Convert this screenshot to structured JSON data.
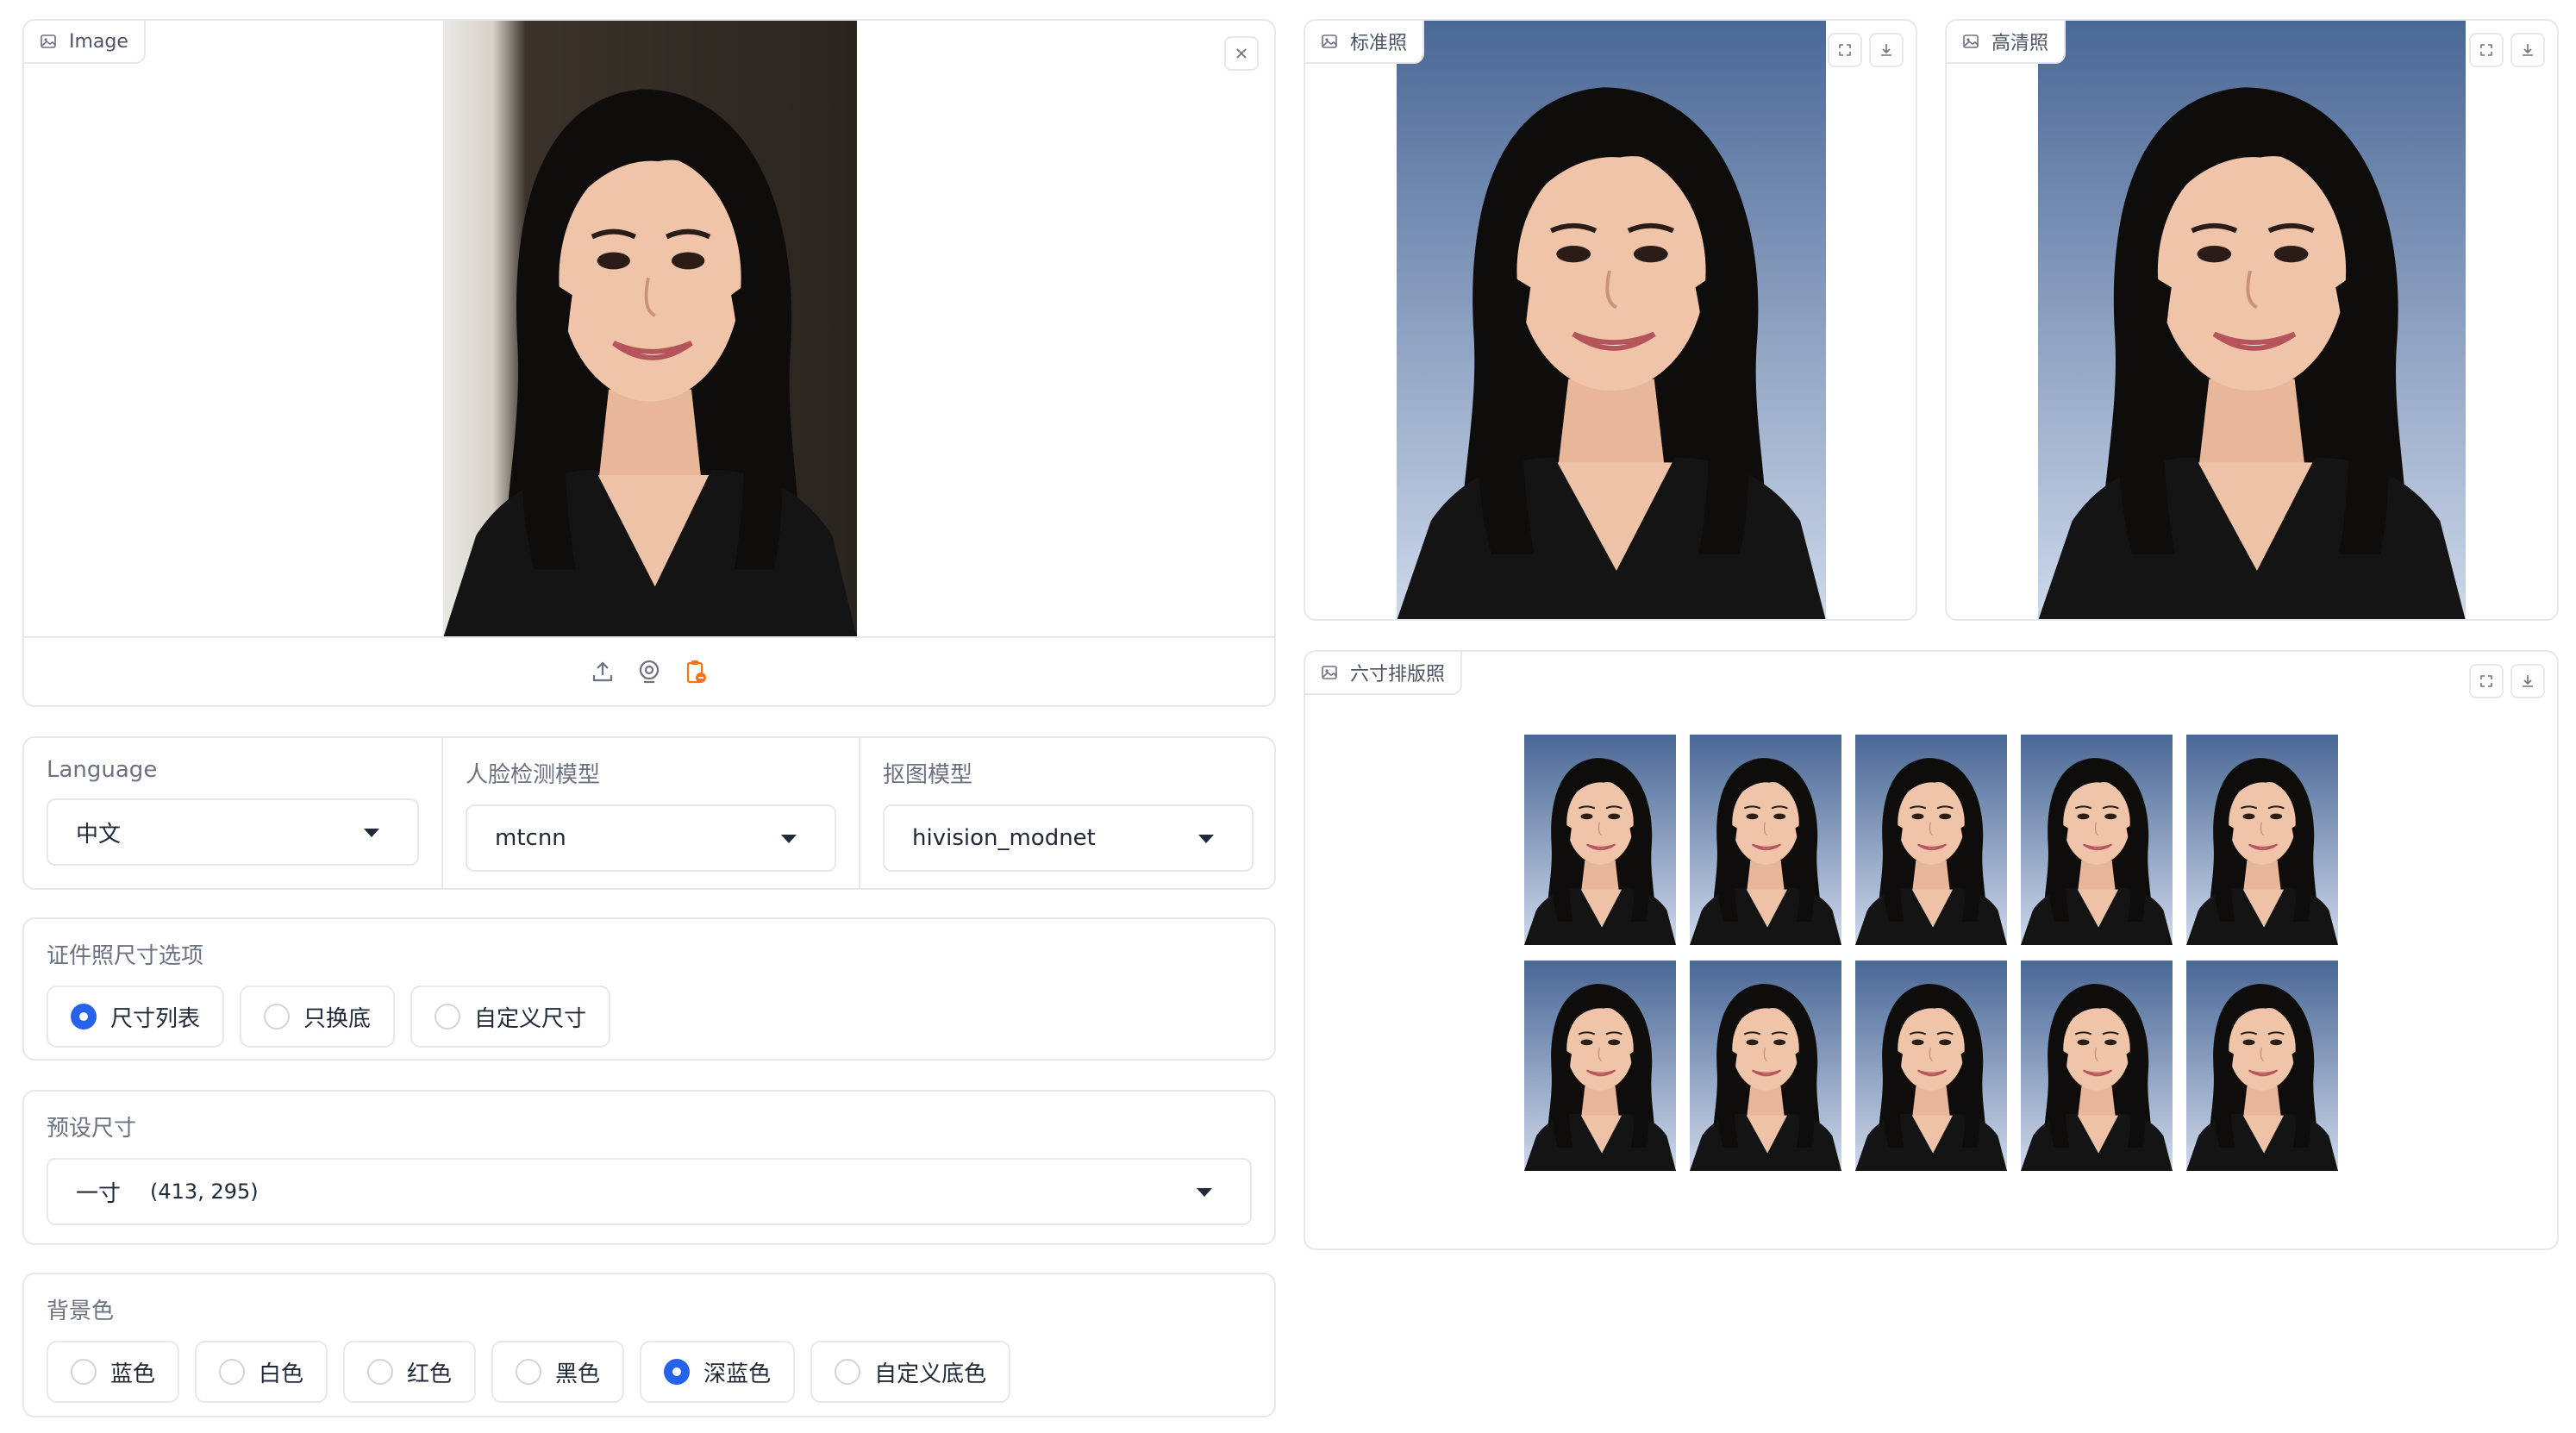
{
  "input_image": {
    "label": "Image"
  },
  "input_controls": {
    "upload_icon": "upload-icon",
    "webcam_icon": "webcam-icon",
    "clipboard_icon": "clipboard-icon"
  },
  "output_standard": {
    "label": "标准照"
  },
  "output_hd": {
    "label": "高清照"
  },
  "output_layout": {
    "label": "六寸排版照",
    "thumbnail_count": 10
  },
  "language": {
    "label": "Language",
    "value": "中文"
  },
  "face_model": {
    "label": "人脸检测模型",
    "value": "mtcnn"
  },
  "matting_model": {
    "label": "抠图模型",
    "value": "hivision_modnet"
  },
  "size_option": {
    "label": "证件照尺寸选项",
    "options": [
      {
        "label": "尺寸列表",
        "selected": true
      },
      {
        "label": "只换底",
        "selected": false
      },
      {
        "label": "自定义尺寸",
        "selected": false
      }
    ]
  },
  "preset_size": {
    "label": "预设尺寸",
    "name": "一寸",
    "dims": "(413, 295)"
  },
  "background_color": {
    "label": "背景色",
    "options": [
      {
        "label": "蓝色",
        "selected": false
      },
      {
        "label": "白色",
        "selected": false
      },
      {
        "label": "红色",
        "selected": false
      },
      {
        "label": "黑色",
        "selected": false
      },
      {
        "label": "深蓝色",
        "selected": true
      },
      {
        "label": "自定义底色",
        "selected": false
      }
    ]
  },
  "colors": {
    "accent": "#2563eb",
    "border": "#e5e7eb",
    "idphoto_bg_top": "#4b6a9b",
    "idphoto_bg_bottom": "#c9d6ea",
    "source_bg": "#2a2622"
  }
}
